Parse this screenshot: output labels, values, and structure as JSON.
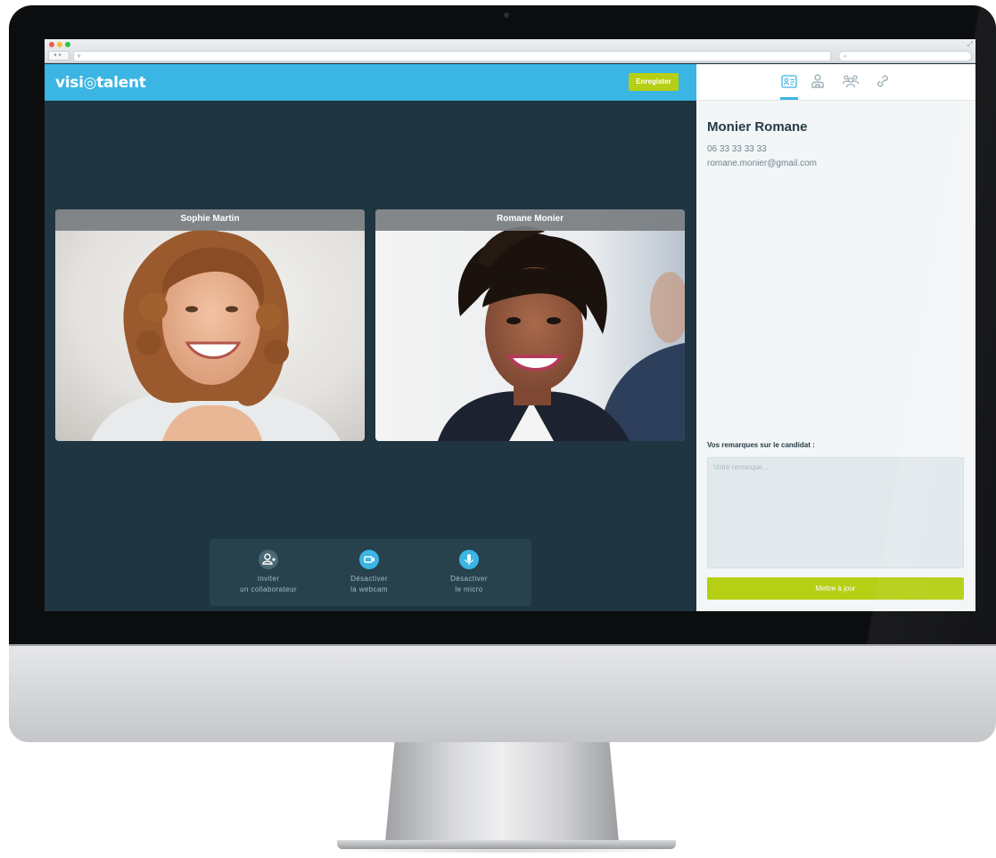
{
  "app": {
    "logo_text": "visi◎talent",
    "save_button": "Enregister",
    "brand_color": "#3ab5e4",
    "accent_color": "#b5cf14"
  },
  "browser": {
    "new_tab_symbol": "+",
    "search_icon": "search-icon"
  },
  "videos": [
    {
      "name": "Sophie Martin"
    },
    {
      "name": "Romane Monier"
    }
  ],
  "controls": {
    "invite_label": "Inviter\nun collaborateur",
    "webcam_label": "Désactiver\nla webcam",
    "mic_label": "Désactiver\nle micro"
  },
  "panel": {
    "tabs": [
      "id-card-icon",
      "person-icon",
      "group-icon",
      "link-icon"
    ],
    "active_tab": 0,
    "candidate": {
      "name": "Monier Romane",
      "phone": "06 33 33 33 33",
      "email": "romane.monier@gmail.com"
    },
    "remarks_label": "Vos remarques sur le candidat :",
    "remarks_placeholder": "Votre remarque...",
    "update_button": "Mettre à jour"
  }
}
